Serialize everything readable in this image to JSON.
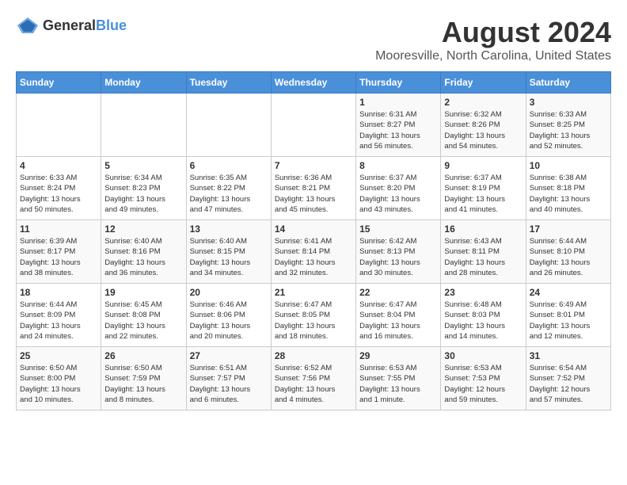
{
  "header": {
    "logo_general": "General",
    "logo_blue": "Blue",
    "title": "August 2024",
    "subtitle": "Mooresville, North Carolina, United States"
  },
  "days_of_week": [
    "Sunday",
    "Monday",
    "Tuesday",
    "Wednesday",
    "Thursday",
    "Friday",
    "Saturday"
  ],
  "weeks": [
    [
      {
        "day": "",
        "info": ""
      },
      {
        "day": "",
        "info": ""
      },
      {
        "day": "",
        "info": ""
      },
      {
        "day": "",
        "info": ""
      },
      {
        "day": "1",
        "info": "Sunrise: 6:31 AM\nSunset: 8:27 PM\nDaylight: 13 hours\nand 56 minutes."
      },
      {
        "day": "2",
        "info": "Sunrise: 6:32 AM\nSunset: 8:26 PM\nDaylight: 13 hours\nand 54 minutes."
      },
      {
        "day": "3",
        "info": "Sunrise: 6:33 AM\nSunset: 8:25 PM\nDaylight: 13 hours\nand 52 minutes."
      }
    ],
    [
      {
        "day": "4",
        "info": "Sunrise: 6:33 AM\nSunset: 8:24 PM\nDaylight: 13 hours\nand 50 minutes."
      },
      {
        "day": "5",
        "info": "Sunrise: 6:34 AM\nSunset: 8:23 PM\nDaylight: 13 hours\nand 49 minutes."
      },
      {
        "day": "6",
        "info": "Sunrise: 6:35 AM\nSunset: 8:22 PM\nDaylight: 13 hours\nand 47 minutes."
      },
      {
        "day": "7",
        "info": "Sunrise: 6:36 AM\nSunset: 8:21 PM\nDaylight: 13 hours\nand 45 minutes."
      },
      {
        "day": "8",
        "info": "Sunrise: 6:37 AM\nSunset: 8:20 PM\nDaylight: 13 hours\nand 43 minutes."
      },
      {
        "day": "9",
        "info": "Sunrise: 6:37 AM\nSunset: 8:19 PM\nDaylight: 13 hours\nand 41 minutes."
      },
      {
        "day": "10",
        "info": "Sunrise: 6:38 AM\nSunset: 8:18 PM\nDaylight: 13 hours\nand 40 minutes."
      }
    ],
    [
      {
        "day": "11",
        "info": "Sunrise: 6:39 AM\nSunset: 8:17 PM\nDaylight: 13 hours\nand 38 minutes."
      },
      {
        "day": "12",
        "info": "Sunrise: 6:40 AM\nSunset: 8:16 PM\nDaylight: 13 hours\nand 36 minutes."
      },
      {
        "day": "13",
        "info": "Sunrise: 6:40 AM\nSunset: 8:15 PM\nDaylight: 13 hours\nand 34 minutes."
      },
      {
        "day": "14",
        "info": "Sunrise: 6:41 AM\nSunset: 8:14 PM\nDaylight: 13 hours\nand 32 minutes."
      },
      {
        "day": "15",
        "info": "Sunrise: 6:42 AM\nSunset: 8:13 PM\nDaylight: 13 hours\nand 30 minutes."
      },
      {
        "day": "16",
        "info": "Sunrise: 6:43 AM\nSunset: 8:11 PM\nDaylight: 13 hours\nand 28 minutes."
      },
      {
        "day": "17",
        "info": "Sunrise: 6:44 AM\nSunset: 8:10 PM\nDaylight: 13 hours\nand 26 minutes."
      }
    ],
    [
      {
        "day": "18",
        "info": "Sunrise: 6:44 AM\nSunset: 8:09 PM\nDaylight: 13 hours\nand 24 minutes."
      },
      {
        "day": "19",
        "info": "Sunrise: 6:45 AM\nSunset: 8:08 PM\nDaylight: 13 hours\nand 22 minutes."
      },
      {
        "day": "20",
        "info": "Sunrise: 6:46 AM\nSunset: 8:06 PM\nDaylight: 13 hours\nand 20 minutes."
      },
      {
        "day": "21",
        "info": "Sunrise: 6:47 AM\nSunset: 8:05 PM\nDaylight: 13 hours\nand 18 minutes."
      },
      {
        "day": "22",
        "info": "Sunrise: 6:47 AM\nSunset: 8:04 PM\nDaylight: 13 hours\nand 16 minutes."
      },
      {
        "day": "23",
        "info": "Sunrise: 6:48 AM\nSunset: 8:03 PM\nDaylight: 13 hours\nand 14 minutes."
      },
      {
        "day": "24",
        "info": "Sunrise: 6:49 AM\nSunset: 8:01 PM\nDaylight: 13 hours\nand 12 minutes."
      }
    ],
    [
      {
        "day": "25",
        "info": "Sunrise: 6:50 AM\nSunset: 8:00 PM\nDaylight: 13 hours\nand 10 minutes."
      },
      {
        "day": "26",
        "info": "Sunrise: 6:50 AM\nSunset: 7:59 PM\nDaylight: 13 hours\nand 8 minutes."
      },
      {
        "day": "27",
        "info": "Sunrise: 6:51 AM\nSunset: 7:57 PM\nDaylight: 13 hours\nand 6 minutes."
      },
      {
        "day": "28",
        "info": "Sunrise: 6:52 AM\nSunset: 7:56 PM\nDaylight: 13 hours\nand 4 minutes."
      },
      {
        "day": "29",
        "info": "Sunrise: 6:53 AM\nSunset: 7:55 PM\nDaylight: 13 hours\nand 1 minute."
      },
      {
        "day": "30",
        "info": "Sunrise: 6:53 AM\nSunset: 7:53 PM\nDaylight: 12 hours\nand 59 minutes."
      },
      {
        "day": "31",
        "info": "Sunrise: 6:54 AM\nSunset: 7:52 PM\nDaylight: 12 hours\nand 57 minutes."
      }
    ]
  ]
}
